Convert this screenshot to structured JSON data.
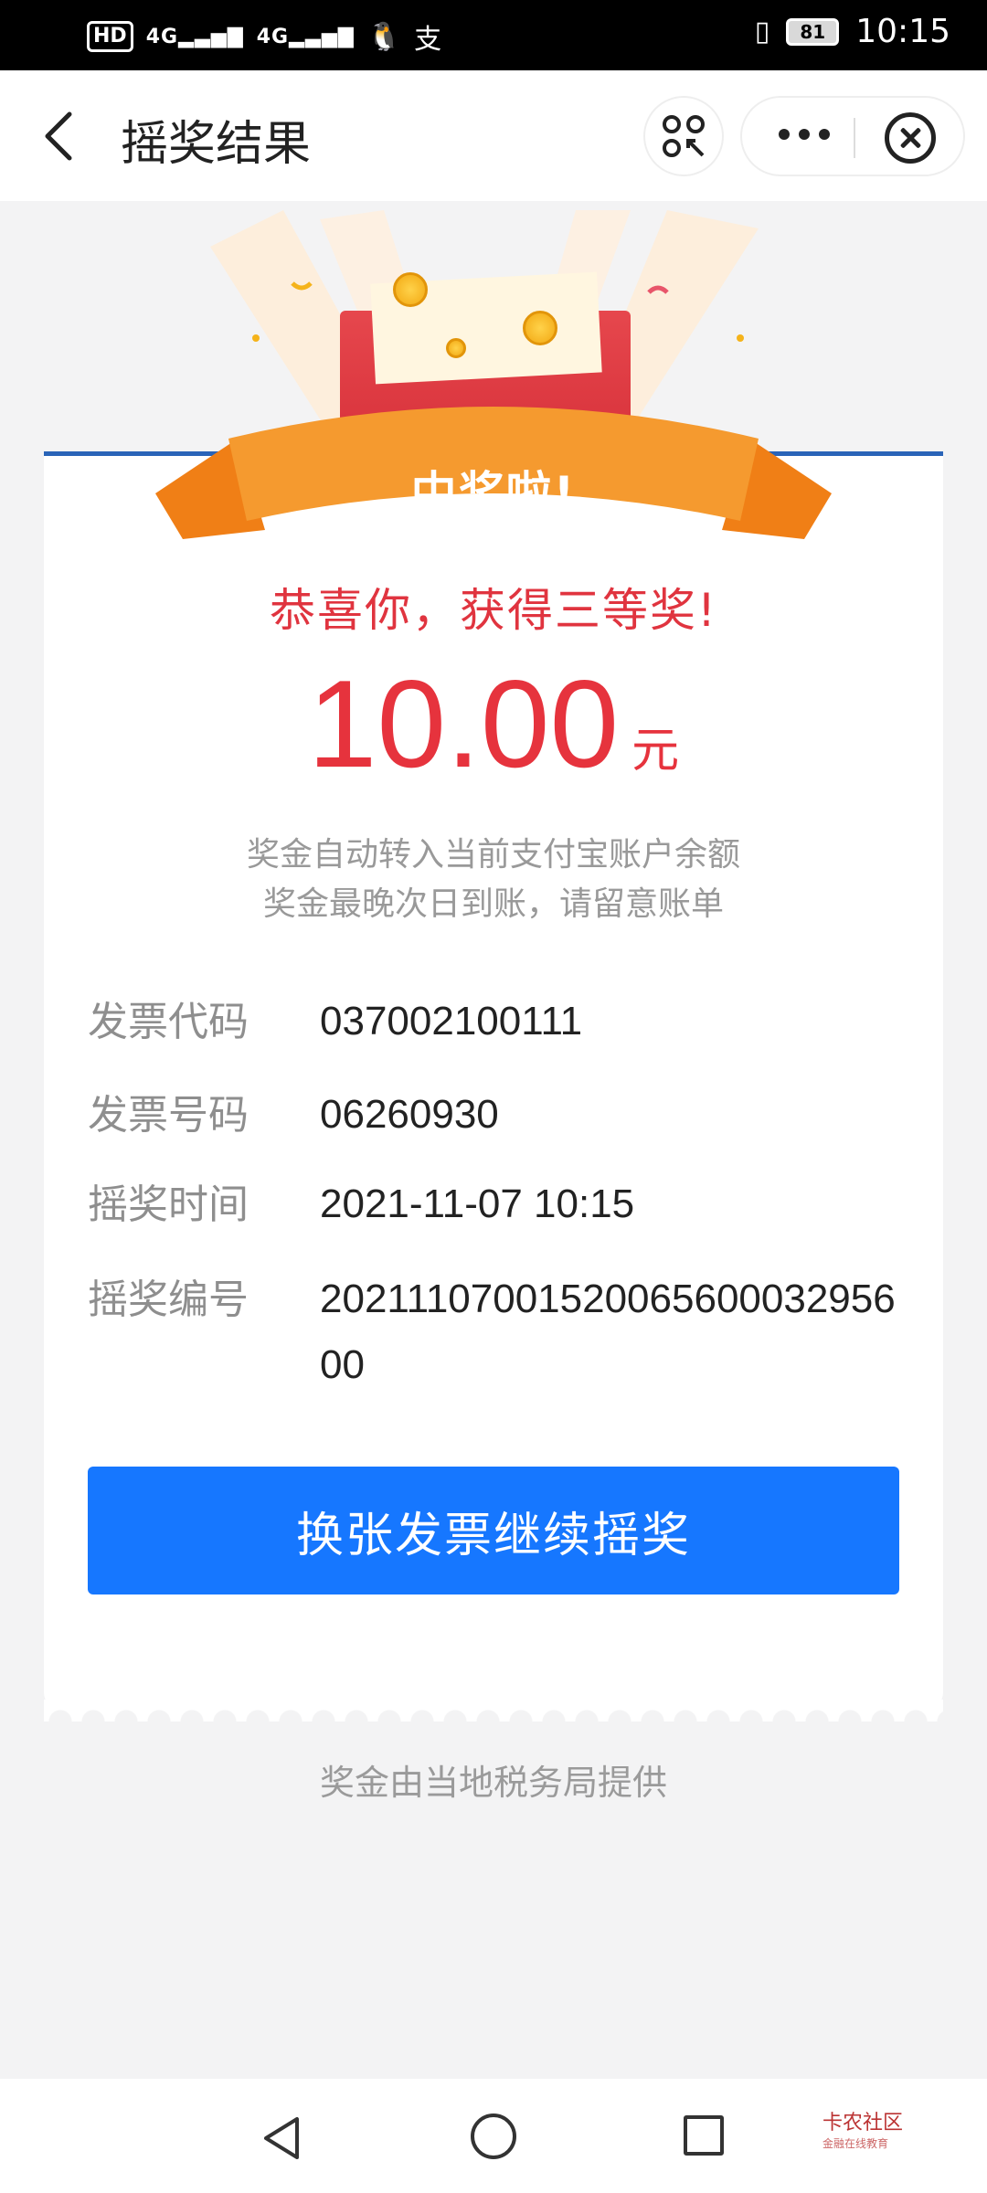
{
  "status_bar": {
    "hd": "HD",
    "sim1": "1",
    "sig1": "4G",
    "sig2": "4G",
    "battery": "81",
    "time": "10:15"
  },
  "header": {
    "title": "摇奖结果"
  },
  "result": {
    "banner": "中奖啦!",
    "congrats": "恭喜你，获得三等奖!",
    "amount": "10.00",
    "unit": "元",
    "note1": "奖金自动转入当前支付宝账户余额",
    "note2": "奖金最晚次日到账，请留意账单"
  },
  "details": [
    {
      "label": "发票代码",
      "value": "037002100111"
    },
    {
      "label": "发票号码",
      "value": "06260930"
    },
    {
      "label": "摇奖时间",
      "value": "2021-11-07 10:15"
    },
    {
      "label": "摇奖编号",
      "value": "2021110700152006560003295600"
    }
  ],
  "action": {
    "button": "换张发票继续摇奖"
  },
  "footer": {
    "text": "奖金由当地税务局提供"
  },
  "watermark": {
    "name": "卡农社区",
    "sub": "金融在线教育"
  },
  "colors": {
    "accent_red": "#e6333d",
    "primary_blue": "#1677ff",
    "banner_orange": "#f59a2f"
  }
}
